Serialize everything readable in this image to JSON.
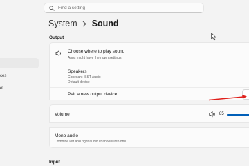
{
  "search": {
    "placeholder": "Find a setting"
  },
  "breadcrumb": {
    "parent": "System",
    "current": "Sound"
  },
  "left_nav": {
    "items": [
      {
        "label": "ces"
      },
      {
        "label": "et"
      }
    ]
  },
  "output": {
    "section_label": "Output",
    "choose": {
      "title": "Choose where to play sound",
      "subtitle": "Apps might have their own settings",
      "icon": "speaker-icon"
    },
    "device": {
      "name": "Speakers",
      "driver": "Conexant ISST Audio",
      "status": "Default device"
    },
    "pair": {
      "title": "Pair a new output device"
    },
    "volume": {
      "label": "Volume",
      "value": "85",
      "level_percent": 85,
      "icon": "volume-icon"
    },
    "mono": {
      "title": "Mono audio",
      "subtitle": "Combine left and right audio channels into one"
    }
  },
  "input": {
    "section_label": "Input"
  },
  "colors": {
    "accent": "#005fb8",
    "annotation_arrow": "#e0201b",
    "background": "#f3f3f3",
    "card": "#fbfbfb"
  }
}
